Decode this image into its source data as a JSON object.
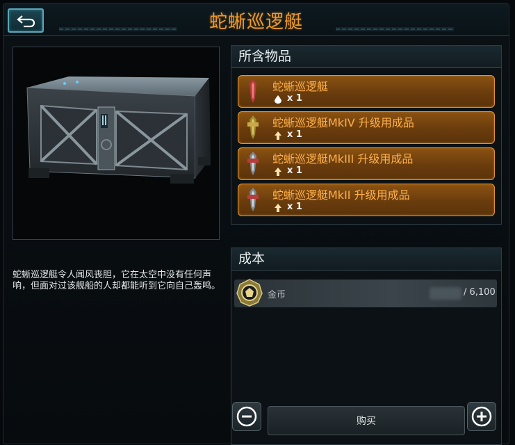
{
  "header": {
    "title": "蛇蜥巡逻艇",
    "back_icon": "back-arrow-icon"
  },
  "preview": {
    "image": "crate-image"
  },
  "description": "蛇蜥巡逻艇令人闻风丧胆，它在太空中没有任何声响，但面对过该舰船的人却都能听到它向自己轰鸣。",
  "contents": {
    "title": "所含物品",
    "items": [
      {
        "name": "蛇蜥巡逻艇",
        "qty_icon": "water-drop-icon",
        "qty": "x 1"
      },
      {
        "name": "蛇蜥巡逻艇MkIV 升级用成品",
        "qty_icon": "upgrade-arrow-icon",
        "qty": "x 1"
      },
      {
        "name": "蛇蜥巡逻艇MkIII 升级用成品",
        "qty_icon": "upgrade-arrow-icon",
        "qty": "x 1"
      },
      {
        "name": "蛇蜥巡逻艇MkII 升级用成品",
        "qty_icon": "upgrade-arrow-icon",
        "qty": "x 1"
      }
    ]
  },
  "cost": {
    "title": "成本",
    "currency": "金币",
    "amount": "/ 6,100"
  },
  "actions": {
    "buy_label": "购买",
    "decrease_icon": "minus-icon",
    "increase_icon": "plus-icon"
  },
  "colors": {
    "title": "#f09a2a",
    "item_fill": "#7a460e",
    "item_border": "#e0942e",
    "item_text": "#ffb04a",
    "accent": "#5aa7b8"
  }
}
